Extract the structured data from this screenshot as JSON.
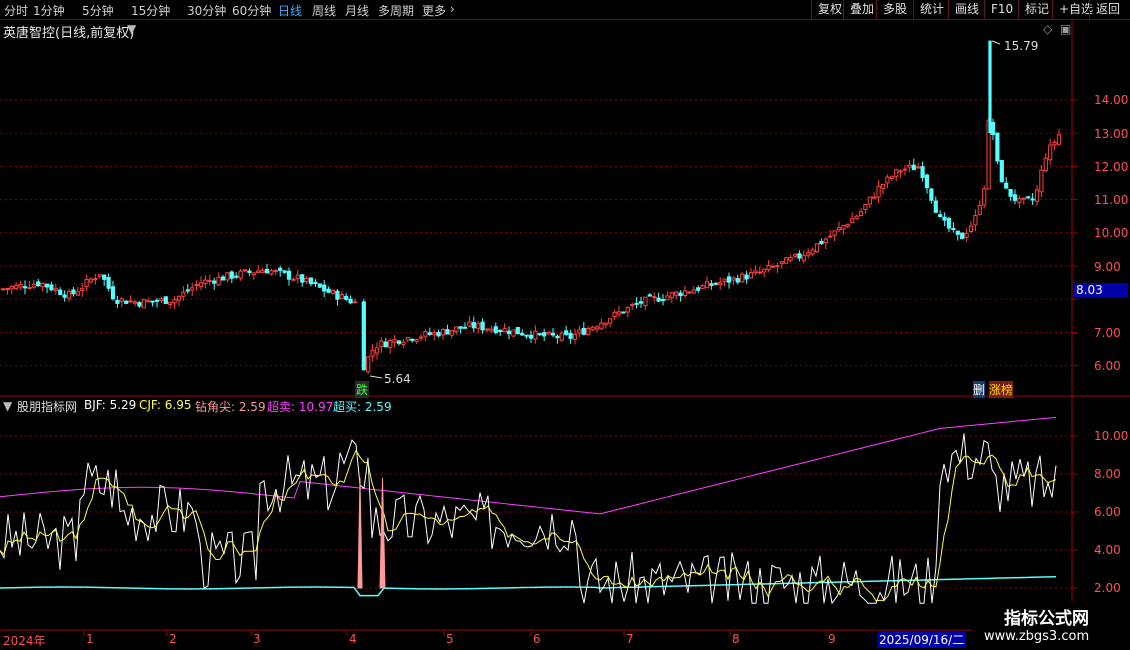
{
  "toolbar": {
    "periods": [
      "分时",
      "1分钟",
      "5分钟",
      "15分钟",
      "30分钟",
      "60分钟",
      "日线",
      "周线",
      "月线",
      "多周期",
      "更多"
    ],
    "active_index": 6,
    "right_buttons": [
      "复权",
      "叠加",
      "多股",
      "统计",
      "画线",
      "F10",
      "+自选",
      "返回"
    ],
    "extra": "标记"
  },
  "main_chart": {
    "title": "英唐智控(日线,前复权)",
    "price_ticks": [
      "14.00",
      "13.00",
      "12.00",
      "11.00",
      "10.00",
      "9.00",
      "8.00",
      "7.00",
      "6.00"
    ],
    "current_price": "8.03",
    "high_label": "15.79",
    "low_label": "5.64",
    "tag_fall": "跌",
    "tag_a": "删",
    "tag_b": "涨榜",
    "colors": {
      "up": "#ff4040",
      "down": "#54ffff",
      "grid": "#8b0000",
      "price_box": "#0000a8"
    }
  },
  "indicator": {
    "name": "股朋指标网",
    "bjf": "BJF: 5.29",
    "cjf": "CJF: 6.95",
    "zjj": "钻角尖: 2.59",
    "cm": "超卖: 10.97",
    "cb": "超买: 2.59",
    "ticks": [
      "10.00",
      "8.00",
      "6.00",
      "4.00",
      "2.00"
    ]
  },
  "time_axis": {
    "labels": [
      "2024年",
      "1",
      "2",
      "3",
      "4",
      "5",
      "6",
      "7",
      "8",
      "9"
    ],
    "highlight": "2025/09/16/二"
  },
  "watermark": {
    "title": "指标公式网",
    "url": "www.zbgs3.com"
  }
}
